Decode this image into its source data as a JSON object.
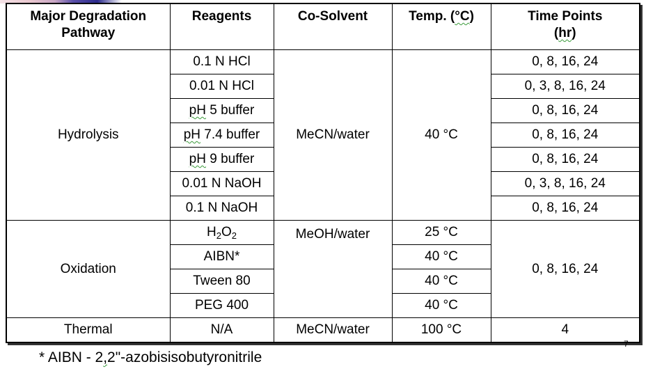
{
  "table": {
    "headers": {
      "pathway_line1": "Major Degradation",
      "pathway_line2": "Pathway",
      "reagents": "Reagents",
      "cosolvent": "Co-Solvent",
      "temp_prefix": "Temp. (",
      "temp_unit": "°C",
      "temp_suffix": ")",
      "time_line1": "Time Points",
      "time_line2_open": "(",
      "time_line2_unit": "hr",
      "time_line2_close": ")"
    },
    "hydrolysis": {
      "pathway": "Hydrolysis",
      "cosolvent": "MeCN/water",
      "temp": "40 °C",
      "rows": [
        {
          "reagent_pre": "",
          "reagent_squig": "",
          "reagent": "0.1 N HCl",
          "time": "0, 8, 16, 24"
        },
        {
          "reagent_pre": "",
          "reagent_squig": "",
          "reagent": "0.01 N HCl",
          "time": "0, 3, 8, 16, 24"
        },
        {
          "reagent_squig": "pH",
          "reagent": " 5 buffer",
          "time": "0, 8, 16, 24"
        },
        {
          "reagent_squig": "pH",
          "reagent": " 7.4 buffer",
          "time": "0, 8, 16, 24"
        },
        {
          "reagent_squig": "pH",
          "reagent": " 9 buffer",
          "time": "0, 8, 16, 24"
        },
        {
          "reagent_squig": "",
          "reagent": "0.01 N NaOH",
          "time": "0, 3, 8, 16, 24"
        },
        {
          "reagent_squig": "",
          "reagent": "0.1 N NaOH",
          "time": "0, 8, 16, 24"
        }
      ]
    },
    "oxidation": {
      "pathway": "Oxidation",
      "cosolvent": "MeOH/water",
      "time": "0, 8, 16, 24",
      "rows": [
        {
          "reagent_h": "H",
          "reagent_sub1": "2",
          "reagent_o": "O",
          "reagent_sub2": "2",
          "temp": "25 °C"
        },
        {
          "reagent": "AIBN*",
          "temp": "40 °C"
        },
        {
          "reagent": "Tween 80",
          "temp": "40 °C"
        },
        {
          "reagent": "PEG 400",
          "temp": "40 °C"
        }
      ]
    },
    "thermal": {
      "pathway": "Thermal",
      "reagent": "N/A",
      "cosolvent": "MeCN/water",
      "temp": "100 °C",
      "time": "4"
    }
  },
  "footnote": {
    "prefix": "* AIBN - 2",
    "squig": ",",
    "suffix": "2\"-azobisisobutyronitrile"
  },
  "page_number": "7"
}
